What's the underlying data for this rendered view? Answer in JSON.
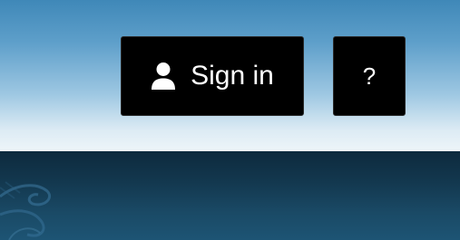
{
  "header": {
    "signin_button": {
      "label": "Sign in",
      "icon": "user-icon"
    },
    "help_button": {
      "label": "?"
    }
  },
  "colors": {
    "header_top": "#3f88b8",
    "header_bottom": "#eef5f9",
    "button_bg": "#000000",
    "button_text": "#ffffff",
    "backdrop": "#13384f"
  }
}
